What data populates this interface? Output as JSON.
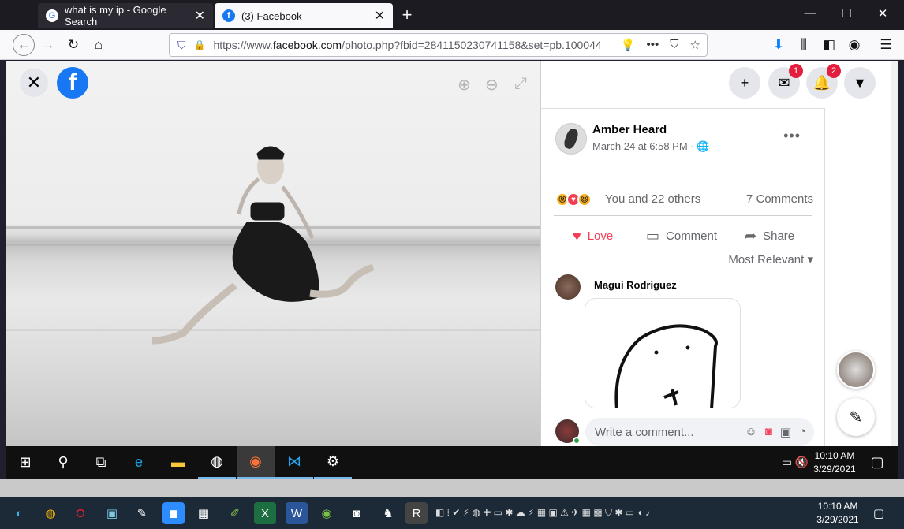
{
  "tabs": [
    {
      "title": "what is my ip - Google Search",
      "favicon": "google-icon"
    },
    {
      "title": "(3) Facebook",
      "favicon": "facebook-icon"
    }
  ],
  "url": {
    "prefix": "https://www.",
    "domain": "facebook.com",
    "path": "/photo.php?fbid=2841150230741158&set=pb.100044"
  },
  "facebook": {
    "badges": {
      "messenger": "1",
      "notifications": "2"
    },
    "post": {
      "author": "Amber Heard",
      "time": "March 24 at 6:58 PM · 🌐",
      "more": "•••",
      "reactions_text": "You and 22 others",
      "comments_count": "7 Comments",
      "actions": {
        "love": "Love",
        "comment": "Comment",
        "share": "Share"
      },
      "sort": "Most Relevant ▾"
    },
    "comment": {
      "author": "Magui Rodriguez"
    },
    "write_placeholder": "Write a comment..."
  },
  "taskbar_inner": {
    "time": "10:10 AM",
    "date": "3/29/2021"
  },
  "taskbar_outer": {
    "time": "10:10 AM",
    "date": "3/29/2021"
  },
  "colors": {
    "facebook_blue": "#1877f2",
    "love": "#f33e58",
    "badge": "#e41e3f"
  }
}
